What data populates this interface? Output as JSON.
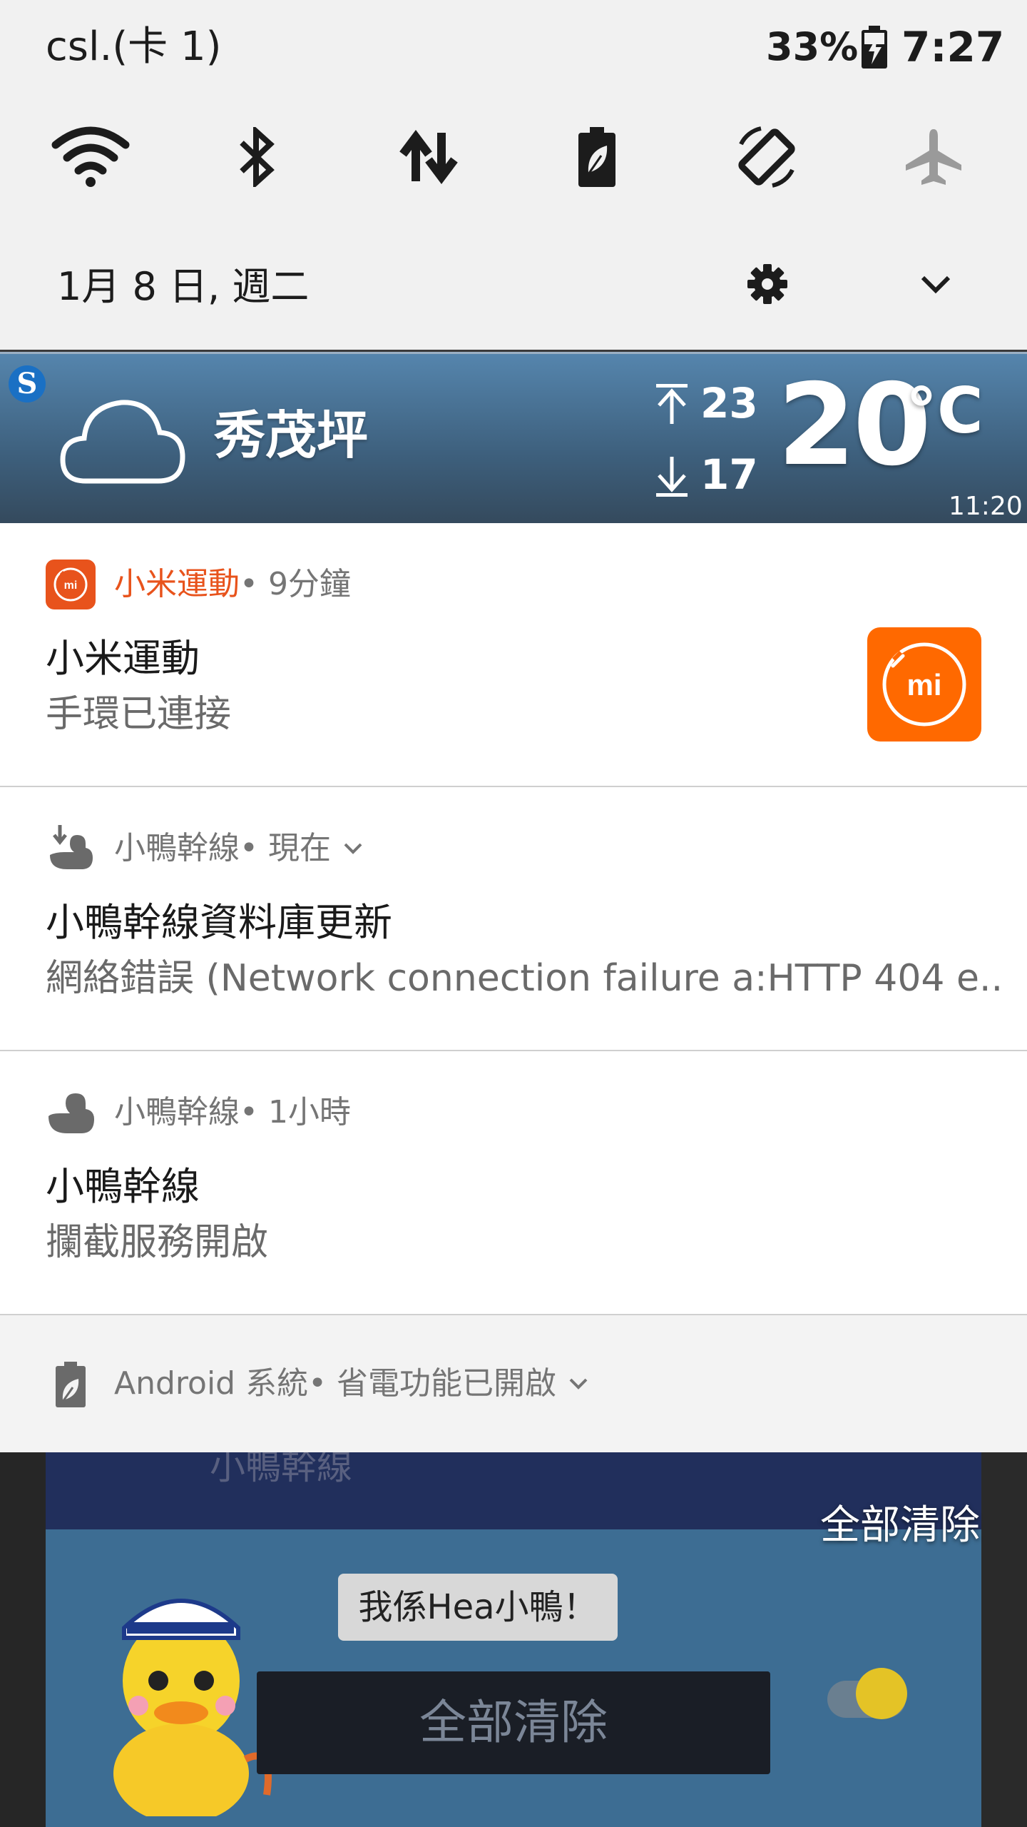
{
  "status_bar": {
    "carrier": "csl.(卡 1)",
    "battery_percent": "33%",
    "time": "7:27"
  },
  "quick_settings": {
    "toggles": [
      {
        "name": "wifi-icon",
        "active": true
      },
      {
        "name": "bluetooth-icon",
        "active": true
      },
      {
        "name": "mobile-data-icon",
        "active": true
      },
      {
        "name": "battery-saver-icon",
        "active": true
      },
      {
        "name": "auto-rotate-icon",
        "active": true
      },
      {
        "name": "airplane-mode-icon",
        "active": false
      }
    ],
    "date": "1月 8 日, 週二"
  },
  "weather": {
    "location": "秀茂坪",
    "high": "23",
    "low": "17",
    "current_temp": "20",
    "unit": "°C",
    "updated": "11:20",
    "app_icon_letter": "S"
  },
  "notifications": [
    {
      "app": "小米運動",
      "app_color": "#e8531c",
      "meta": " • 9分鐘",
      "title": "小米運動",
      "body": "手環已連接",
      "icon_label": "mi"
    },
    {
      "app": "小鴨幹線",
      "meta": " • 現在",
      "title": "小鴨幹線資料庫更新",
      "body": "網絡錯誤 (Network connection failure a:HTTP 404 e.."
    },
    {
      "app": "小鴨幹線",
      "meta": " • 1小時",
      "title": "小鴨幹線",
      "body": "攔截服務開啟"
    },
    {
      "app": "Android 系統",
      "meta": " • 省電功能已開啟"
    }
  ],
  "clear_all": "全部清除",
  "background_app": {
    "name": "小鴨幹線",
    "speech": "我係Hea小鴨！",
    "clear_button": "全部清除"
  },
  "colors": {
    "accent_orange": "#ff6900",
    "weather_bg": "#4a7090"
  }
}
